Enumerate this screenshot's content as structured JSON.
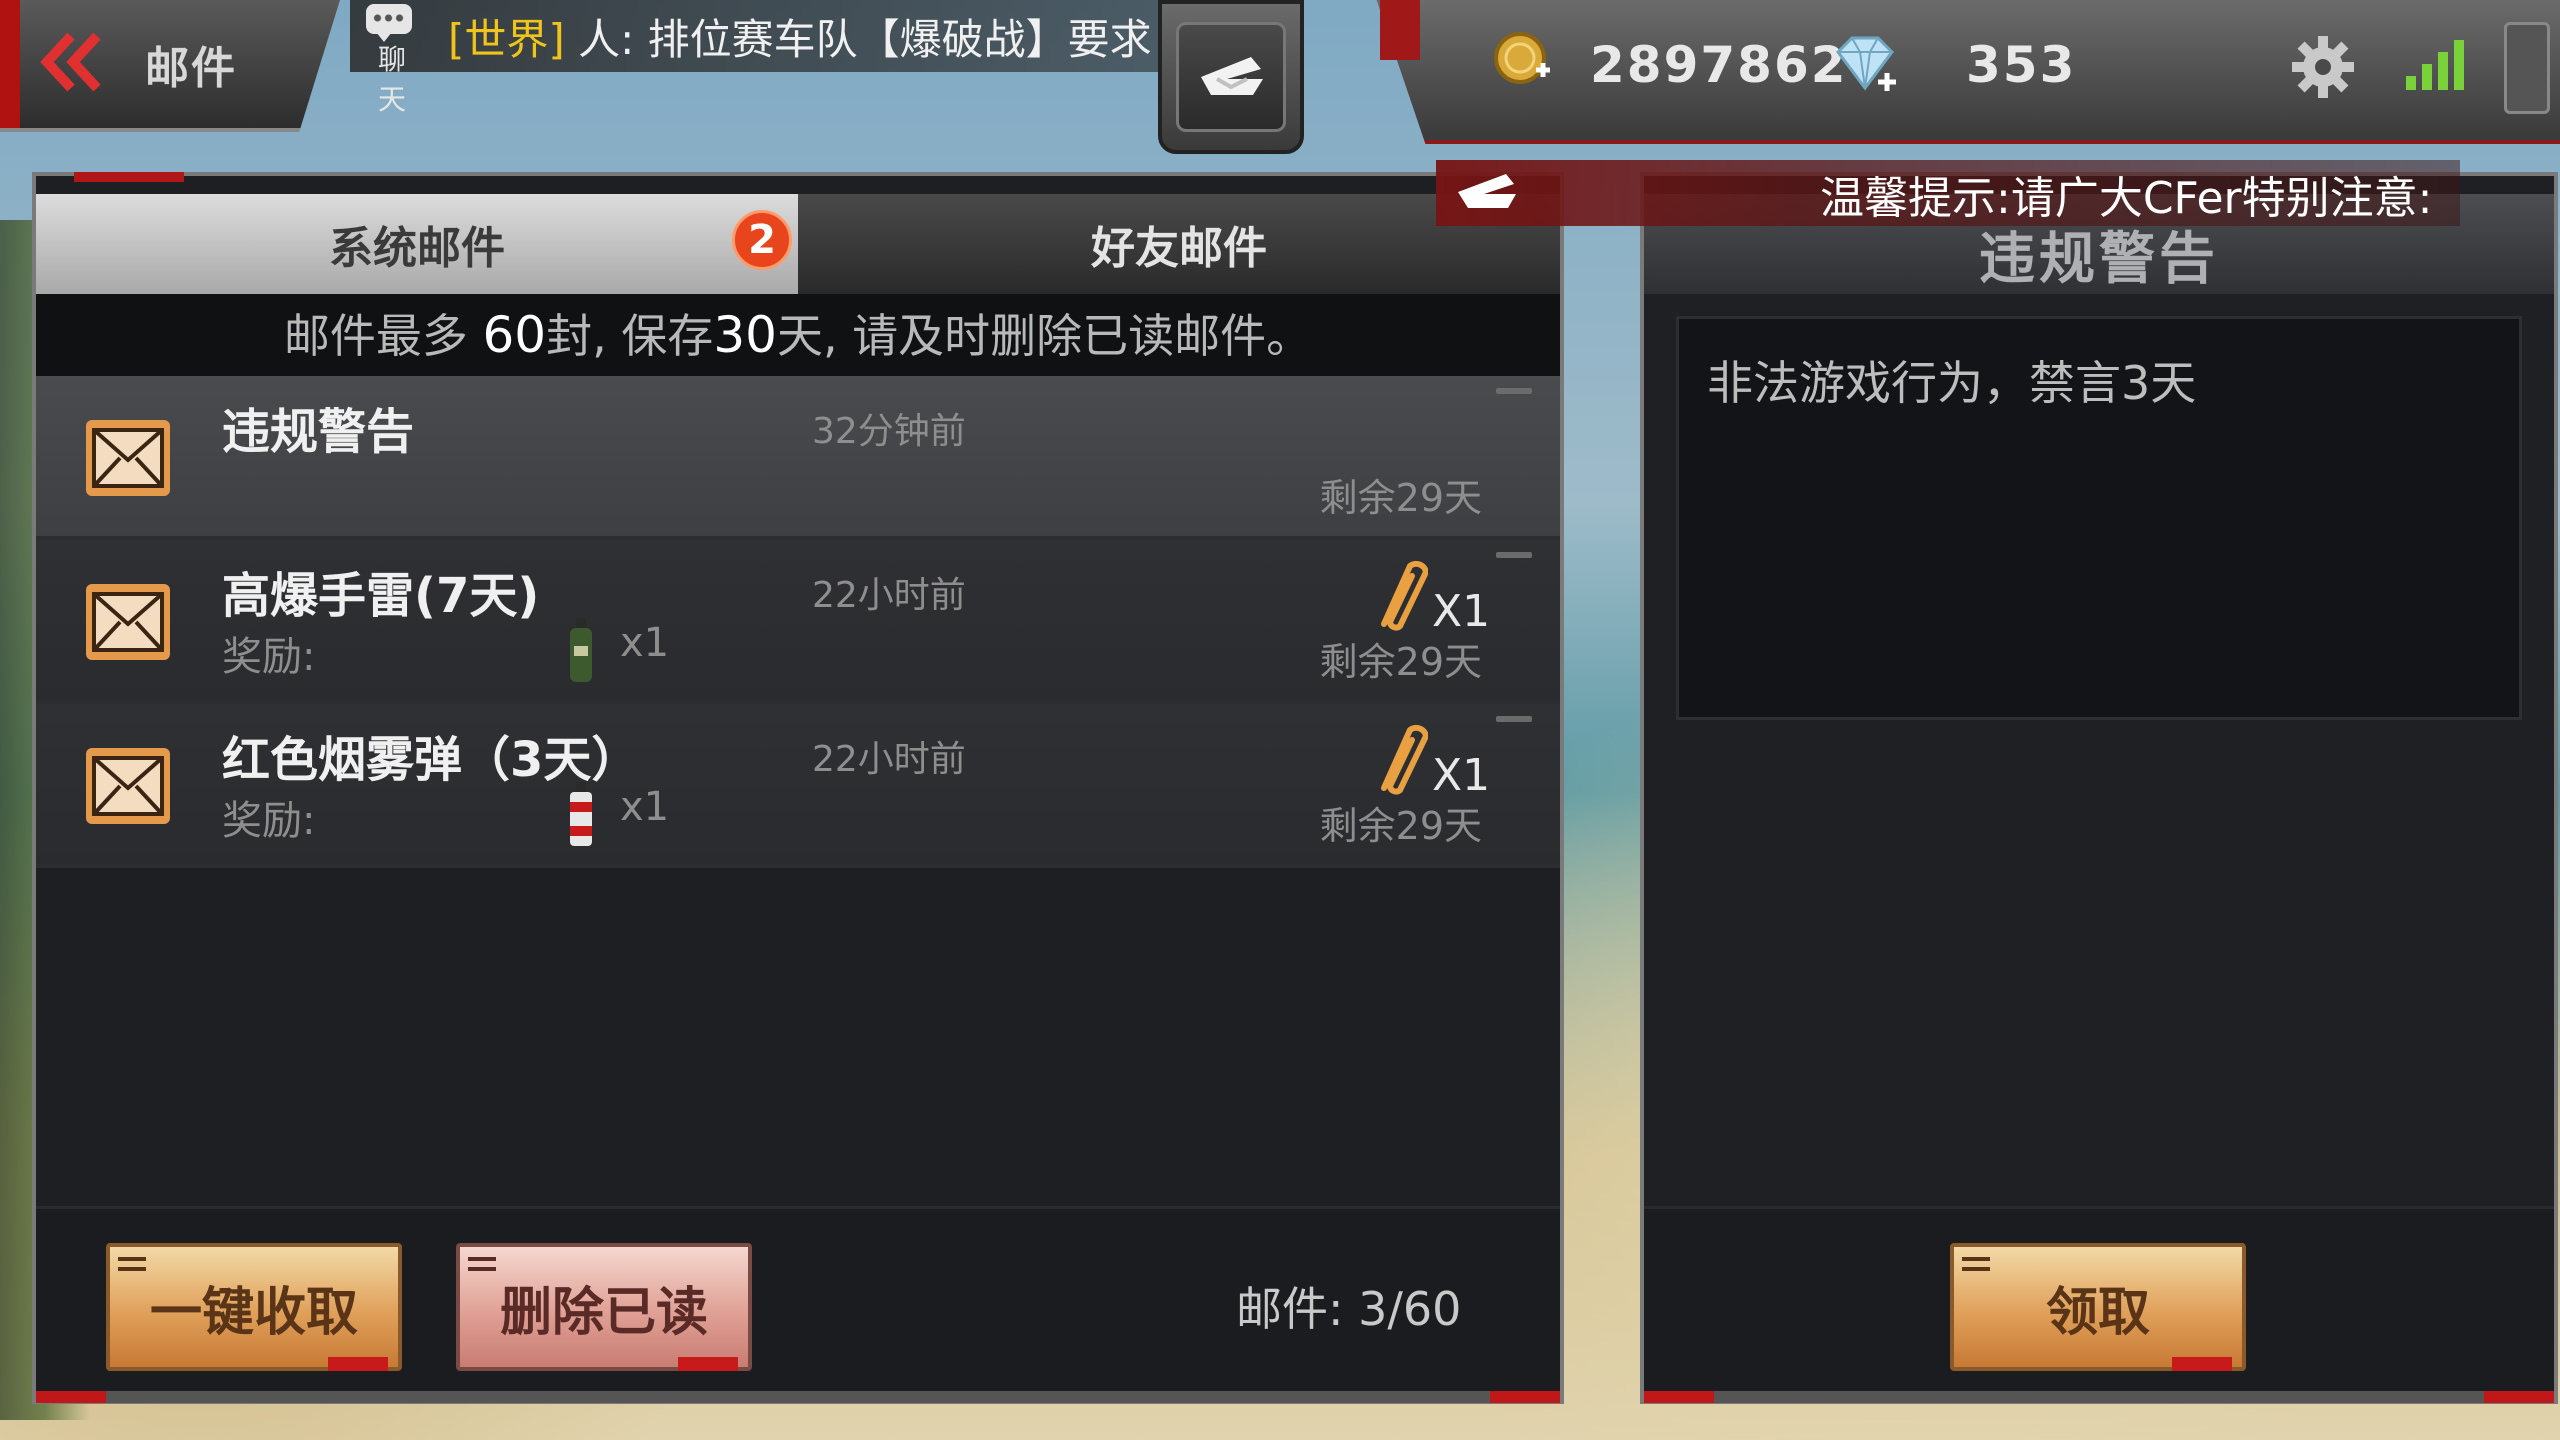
{
  "header": {
    "title": "邮件",
    "back_icon": "double-chevron-left-icon",
    "chat": {
      "icon_label": "聊天",
      "channel": "[世界]",
      "message": "人: 排位赛车队【爆破战】要求"
    },
    "currency": {
      "coins": "2897862",
      "diamonds": "353"
    }
  },
  "tip": {
    "text": "温馨提示:请广大CFer特别注意:"
  },
  "tabs": [
    {
      "label": "系统邮件",
      "badge": "2",
      "active": true
    },
    {
      "label": "好友邮件",
      "active": false
    }
  ],
  "notice": {
    "prefix": "邮件最多 ",
    "max": "60",
    "mid": "封, 保存",
    "days": "30",
    "suffix": "天, 请及时删除已读邮件。"
  },
  "mails": [
    {
      "title": "违规警告",
      "time": "32分钟前",
      "remaining": "剩余29天",
      "selected": true
    },
    {
      "title": "高爆手雷(7天)",
      "time": "22小时前",
      "reward_label": "奖励:",
      "reward_count": "x1",
      "attach_count": "X1",
      "remaining": "剩余29天"
    },
    {
      "title": "红色烟雾弹（3天）",
      "time": "22小时前",
      "reward_label": "奖励:",
      "reward_count": "x1",
      "attach_count": "X1",
      "remaining": "剩余29天"
    }
  ],
  "footer": {
    "collect_all": "一键收取",
    "delete_read": "删除已读",
    "mail_count": "邮件: 3/60"
  },
  "detail": {
    "title": "违规警告",
    "body": "非法游戏行为，禁言3天",
    "claim": "领取"
  },
  "colors": {
    "accent_red": "#b01818",
    "badge": "#e8451d",
    "gold_button": "#e0a05a",
    "channel_yellow": "#f0c419"
  }
}
